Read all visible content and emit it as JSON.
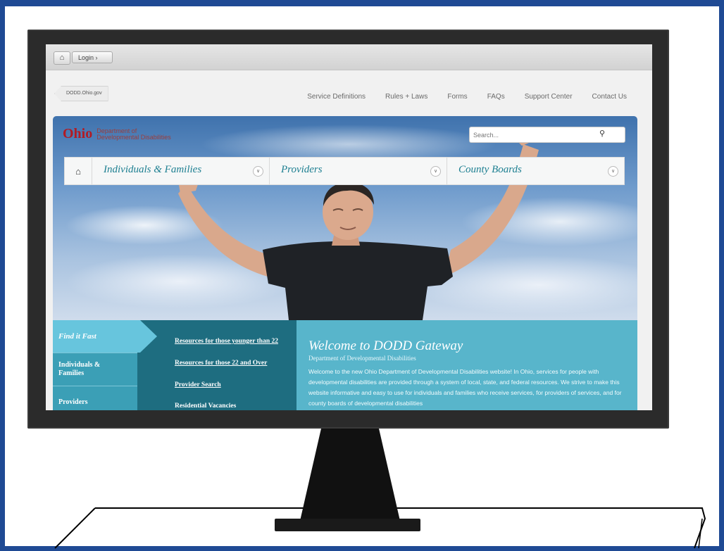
{
  "topbar": {
    "home_icon": "home-icon",
    "login_label": "Login  ›"
  },
  "site_tag": "DODD.Ohio.gov",
  "top_links": [
    "Service Definitions",
    "Rules + Laws",
    "Forms",
    "FAQs",
    "Support Center",
    "Contact Us"
  ],
  "brand": {
    "ohio": "Ohio",
    "dept_line1": "Department of",
    "dept_line2": "Developmental Disabilities"
  },
  "search": {
    "placeholder": "Search...",
    "icon": "search-icon"
  },
  "nav": {
    "home_icon": "home-icon",
    "items": [
      {
        "label": "Individuals & Families"
      },
      {
        "label": "Providers"
      },
      {
        "label": "County Boards"
      }
    ]
  },
  "find_fast": {
    "label": "Find it Fast",
    "items": [
      "Individuals & Families",
      "Providers"
    ]
  },
  "links": [
    "Resources for those younger than 22",
    "Resources for those 22 and Over",
    "Provider Search",
    "Residential Vacancies"
  ],
  "welcome": {
    "title": "Welcome to DODD Gateway",
    "subtitle": "Department of Developmental Disabilities",
    "body": "Welcome to the new Ohio Department of Developmental Disabilities website! In Ohio, services for people with developmental disabilities are provided through a system of local, state, and federal resources. We strive to make this website informative and easy to use for individuals and families who receive services, for providers of services, and for county boards of developmental disabilities"
  },
  "colors": {
    "frame": "#1f4a94",
    "brand_red": "#b11b24",
    "teal_dark": "#1e6d80",
    "teal_light": "#58b5cb",
    "nav_text": "#1d7f91"
  }
}
